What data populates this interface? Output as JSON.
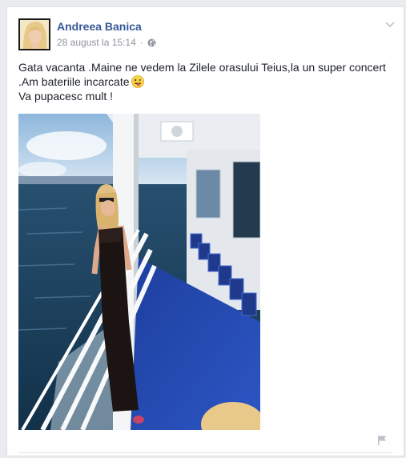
{
  "post": {
    "author_name": "Andreea Banica",
    "timestamp": "28 august la 15:14",
    "separator": "·",
    "privacy_icon": "globe-icon",
    "menu_icon": "chevron-down-icon",
    "text_line1": "Gata vacanta .Maine ne vedem la Zilele orasului Teius,la un super concert .Am bateriile incarcate",
    "text_line2": "Va pupacesc mult !",
    "emoji": "tongue-wink-emoji",
    "photo": "ferry-deck-photo",
    "report_icon": "flag-icon"
  },
  "colors": {
    "author_link": "#365899",
    "meta_text": "#90949c",
    "body_text": "#1d2129",
    "page_bg": "#e9ebee"
  }
}
